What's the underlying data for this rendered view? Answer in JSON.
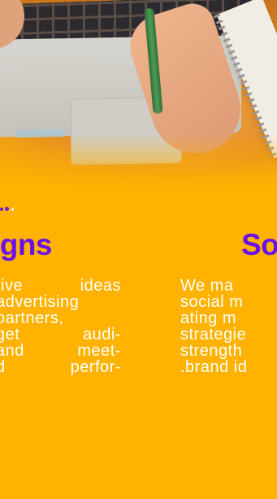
{
  "photo": {
    "alt": "laptop-workspace-photo"
  },
  "carousel": {
    "left_card": {
      "heading": "gns",
      "lines": [
        "tive ideas",
        "advertising",
        "partners,",
        "get audi-",
        "and meet-",
        "d perfor-"
      ]
    },
    "right_card": {
      "heading": "So",
      "lines": [
        "We ma",
        "social m",
        "ating m",
        "strategie",
        "strength",
        ".brand id"
      ]
    }
  },
  "colors": {
    "background": "#FFB300",
    "accent": "#6A11E8",
    "text": "#FFFFFF"
  }
}
